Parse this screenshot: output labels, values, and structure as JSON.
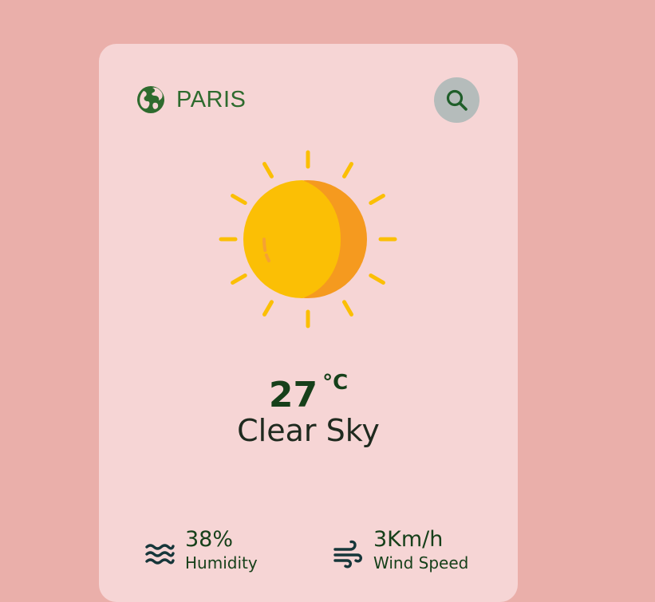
{
  "location": {
    "icon": "globe-icon",
    "city": "PARIS"
  },
  "search": {
    "icon": "search-icon",
    "button_color": "#b5bcbb"
  },
  "weather": {
    "icon": "sun-icon",
    "temperature": "27",
    "unit": "°C",
    "condition": "Clear Sky"
  },
  "stats": {
    "humidity": {
      "icon": "waves-icon",
      "value": "38%",
      "label": "Humidity"
    },
    "wind": {
      "icon": "wind-icon",
      "value": "3Km/h",
      "label": "Wind Speed"
    }
  },
  "colors": {
    "page_background": "#eaafaa",
    "card_background": "#f6d5d5",
    "accent_green": "#2e6b2e",
    "text_dark_green": "#16401a",
    "sun_yellow": "#fbbf05",
    "sun_orange": "#f59a1f"
  }
}
